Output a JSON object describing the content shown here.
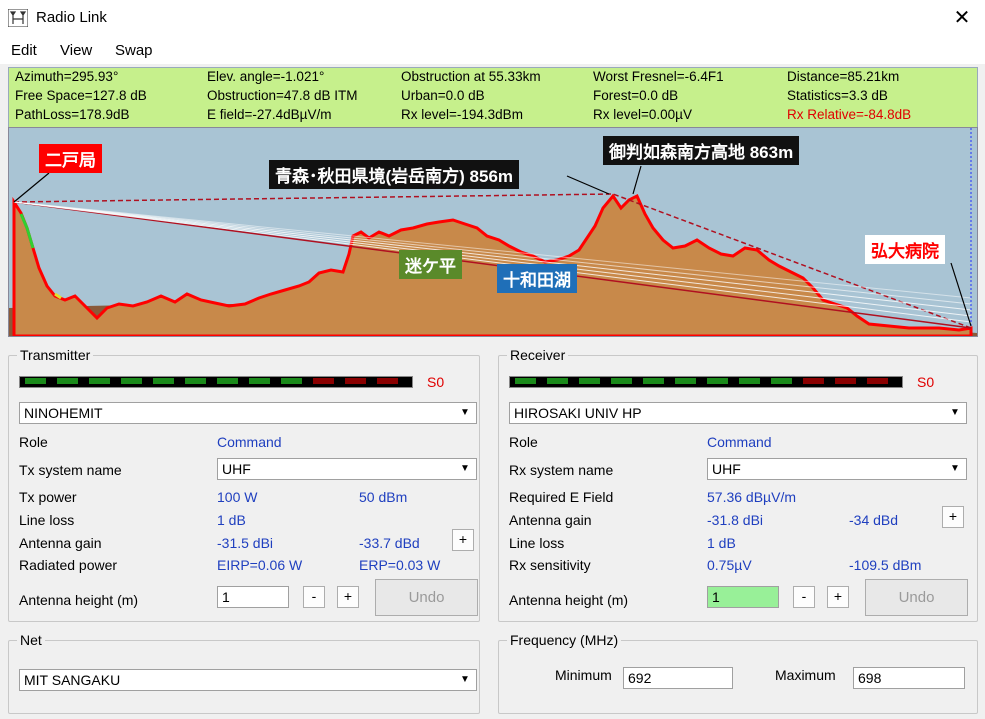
{
  "window": {
    "title": "Radio Link",
    "close_glyph": "✕"
  },
  "menu": [
    "Edit",
    "View",
    "Swap"
  ],
  "info_rows": [
    [
      "Azimuth=295.93°",
      "Elev. angle=-1.021°",
      "Obstruction at 55.33km",
      "Worst Fresnel=-6.4F1",
      "Distance=85.21km"
    ],
    [
      "Free Space=127.8 dB",
      "Obstruction=47.8 dB ITM",
      "Urban=0.0 dB",
      "Forest=0.0 dB",
      "Statistics=3.3 dB"
    ],
    [
      "PathLoss=178.9dB",
      "E field=-27.4dBµV/m",
      "Rx level=-194.3dBm",
      "Rx level=0.00µV",
      "Rx Relative=-84.8dB"
    ]
  ],
  "profile_labels": {
    "ninohe": "二戸局",
    "ridge1": "青森･秋田県境(岩岳南方) 856m",
    "ridge2": "御判如森南方高地 863m",
    "mayogataira": "迷ケ平",
    "towada": "十和田湖",
    "hirodai": "弘大病院"
  },
  "colors": {
    "info_bg": "#c6f08c",
    "sky": "#a9c4d4",
    "terrain": "#c8894a",
    "terrain_line": "#ff0000",
    "label_red": "#ff0000",
    "label_green": "#5a8a2a",
    "label_blue": "#1f6fb8",
    "label_dark": "#111111"
  },
  "transmitter": {
    "title": "Transmitter",
    "signal": "S0",
    "site": "NINOHEMIT",
    "role_label": "Role",
    "role_value": "Command",
    "system_label": "Tx system name",
    "system_value": "UHF",
    "power_label": "Tx power",
    "power_w": "100 W",
    "power_dbm": "50 dBm",
    "loss_label": "Line loss",
    "loss_value": "1 dB",
    "gain_label": "Antenna gain",
    "gain_dbi": "-31.5 dBi",
    "gain_dbd": "-33.7 dBd",
    "radiated_label": "Radiated power",
    "eirp": "EIRP=0.06 W",
    "erp": "ERP=0.03 W",
    "height_label": "Antenna height (m)",
    "height_value": "1",
    "undo": "Undo",
    "minus": "-",
    "plus": "+"
  },
  "receiver": {
    "title": "Receiver",
    "signal": "S0",
    "site": "HIROSAKI UNIV HP",
    "role_label": "Role",
    "role_value": "Command",
    "system_label": "Rx system name",
    "system_value": "UHF",
    "field_label": "Required E Field",
    "field_value": "57.36 dBµV/m",
    "gain_label": "Antenna gain",
    "gain_dbi": "-31.8 dBi",
    "gain_dbd": "-34 dBd",
    "loss_label": "Line loss",
    "loss_value": "1 dB",
    "sens_label": "Rx sensitivity",
    "sens_uv": "0.75µV",
    "sens_dbm": "-109.5 dBm",
    "height_label": "Antenna height (m)",
    "height_value": "1",
    "undo": "Undo",
    "minus": "-",
    "plus": "+"
  },
  "net": {
    "title": "Net",
    "value": "MIT SANGAKU"
  },
  "frequency": {
    "title": "Frequency (MHz)",
    "min_label": "Minimum",
    "min_value": "692",
    "max_label": "Maximum",
    "max_value": "698"
  }
}
